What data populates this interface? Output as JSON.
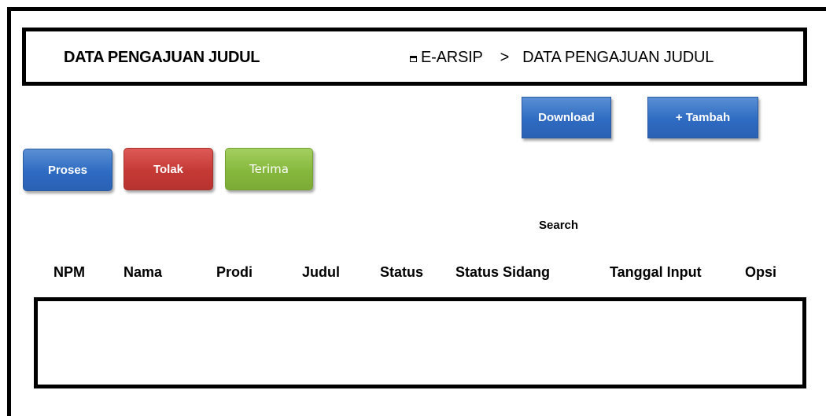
{
  "header": {
    "title": "DATA PENGAJUAN JUDUL",
    "breadcrumb": {
      "icon": "folder-icon",
      "root": "E-ARSIP",
      "separator": ">",
      "current": "DATA PENGAJUAN JUDUL"
    }
  },
  "toolbar": {
    "download_label": "Download",
    "add_label": "+ Tambah"
  },
  "actions": {
    "proses_label": "Proses",
    "tolak_label": "Tolak",
    "terima_label": "Terima"
  },
  "colors": {
    "blue": "#2e6bc2",
    "red": "#c53935",
    "green": "#86b83d"
  },
  "search": {
    "label": "Search"
  },
  "table": {
    "columns": [
      "NPM",
      "Nama",
      "Prodi",
      "Judul",
      "Status",
      "Status Sidang",
      "Tanggal Input",
      "Opsi"
    ],
    "rows": []
  }
}
